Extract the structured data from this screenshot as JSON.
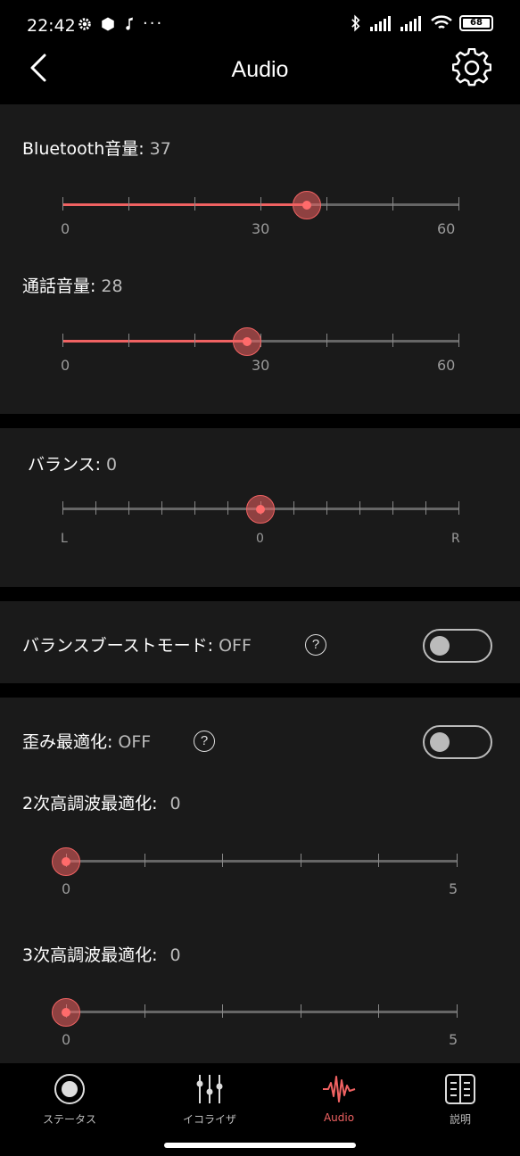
{
  "status_bar": {
    "time": "22:42",
    "battery": "68"
  },
  "header": {
    "title": "Audio"
  },
  "bt_volume": {
    "label": "Bluetooth音量:",
    "value": "37",
    "num": 37,
    "min": 0,
    "max": 60,
    "scale": [
      "0",
      "30",
      "60"
    ]
  },
  "call_volume": {
    "label": "通話音量:",
    "value": "28",
    "num": 28,
    "min": 0,
    "max": 60,
    "scale": [
      "0",
      "30",
      "60"
    ]
  },
  "balance": {
    "label": "バランス:",
    "value": "0",
    "num": 0,
    "min": -10,
    "max": 10,
    "scale": [
      "L",
      "0",
      "R"
    ]
  },
  "balance_boost": {
    "label": "バランスブーストモード:",
    "value": "OFF",
    "help": "?"
  },
  "distortion": {
    "label": "歪み最適化:",
    "value": "OFF",
    "help": "?"
  },
  "harmonic2": {
    "label": "2次高調波最適化:",
    "value": "0",
    "num": 0,
    "min": 0,
    "max": 5,
    "scale": [
      "0",
      "5"
    ]
  },
  "harmonic3": {
    "label": "3次高調波最適化:",
    "value": "0",
    "num": 0,
    "min": 0,
    "max": 5,
    "scale": [
      "0",
      "5"
    ]
  },
  "nav": {
    "status": "ステータス",
    "equalizer": "イコライザ",
    "audio": "Audio",
    "manual": "説明"
  },
  "colors": {
    "accent": "#f06262",
    "card": "#1a1a1a",
    "background": "#000000"
  }
}
